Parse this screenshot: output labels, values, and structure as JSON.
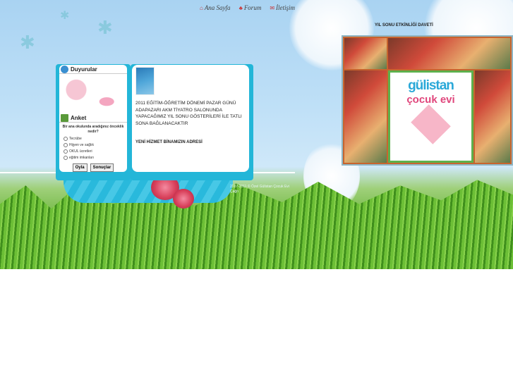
{
  "nav": [
    {
      "icon": "home-icon",
      "label": "Ana Sayfa"
    },
    {
      "icon": "forum-icon",
      "label": "Forum"
    },
    {
      "icon": "mail-icon",
      "label": "İletişim"
    }
  ],
  "announcements": {
    "title": "Duyurular"
  },
  "poll": {
    "title": "Anket",
    "question": "Bir ana okulunda aradığınız önceklik nedir?",
    "options": [
      "Tecrübe",
      "Hijyen ve sağlık",
      "OKUL ücretleri",
      "eğitim imkanları"
    ],
    "vote_label": "Oyla",
    "results_label": "Sonuçlar"
  },
  "news": {
    "text": "2011 EĞİTİM-ÖĞRETİM DÖNEMİ PAZAR GÜNÜ ADAPAZARI AKM TİYATRO SALONUNDA YAPACAĞIMIZ YIL SONU GÖSTERİLERİ İLE TATLI SONA BAĞLANACAKTIR",
    "headline2": "YENİ HİZMET BİNAMIZIN ADRESİ"
  },
  "invitation": {
    "title": "YIL SONU ETKİNLİĞİ DAVETİ",
    "logo_line1": "gülistan",
    "logo_line2": "çocuk evi"
  },
  "footer": "2007-2011 © Özel Gülistan Çocuk Evi Çağrı"
}
